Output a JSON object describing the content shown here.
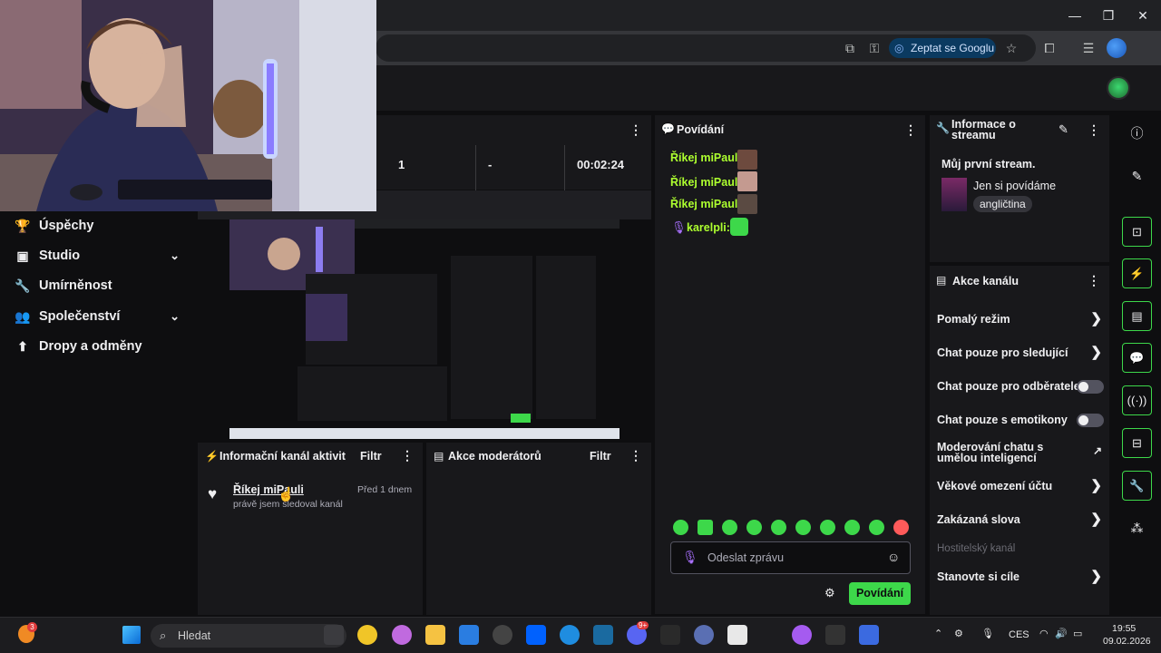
{
  "browser": {
    "ask_google_label": "Zeptat se Googlu"
  },
  "left_nav": {
    "items": [
      {
        "label": "Úspěchy"
      },
      {
        "label": "Studio"
      },
      {
        "label": "Umírněnost"
      },
      {
        "label": "Společenství"
      },
      {
        "label": "Dropy a odměny"
      }
    ]
  },
  "stats": {
    "values": [
      "1",
      "-",
      "00:02:24"
    ]
  },
  "activity_feed": {
    "title": "Informační kanál aktivit",
    "filter_label": "Filtr",
    "item": {
      "name": "Říkej miPauli",
      "time": "Před 1 dnem",
      "text": "právě jsem sledoval kanál"
    }
  },
  "mod_actions": {
    "title": "Akce moderátorů",
    "filter_label": "Filtr"
  },
  "chat": {
    "title": "Povídání",
    "messages": [
      {
        "user": "Říkej miPauli:"
      },
      {
        "user": "Říkej miPauli:"
      },
      {
        "user": "Říkej miPauli:"
      },
      {
        "user": "karelpli:"
      }
    ],
    "input_placeholder": "Odeslat zprávu",
    "send_label": "Povídání"
  },
  "stream_info": {
    "title": "Informace o streamu",
    "stream_title": "Můj první stream.",
    "category": "Jen si povídáme",
    "tag": "angličtina"
  },
  "channel_actions": {
    "title": "Akce kanálu",
    "items": [
      {
        "label": "Pomalý režim"
      },
      {
        "label": "Chat pouze pro sledující"
      },
      {
        "label": "Chat pouze pro odběratele"
      },
      {
        "label": "Chat pouze s emotikony"
      },
      {
        "label": "Moderování chatu s umělou inteligencí"
      },
      {
        "label": "Věkové omezení účtu"
      },
      {
        "label": "Zakázaná slova"
      },
      {
        "label": "Hostitelský kanál"
      },
      {
        "label": "Stanovte si cíle"
      }
    ]
  },
  "taskbar": {
    "search_placeholder": "Hledat",
    "notification_count": "3",
    "badge_count": "9+",
    "language": "CES",
    "time": "19:55",
    "date": "09.02.2026"
  },
  "colors": {
    "accent": "#3dd84a",
    "chat_name": "#adff2f",
    "panel_bg": "#18181b",
    "page_bg": "#0e0e10"
  }
}
